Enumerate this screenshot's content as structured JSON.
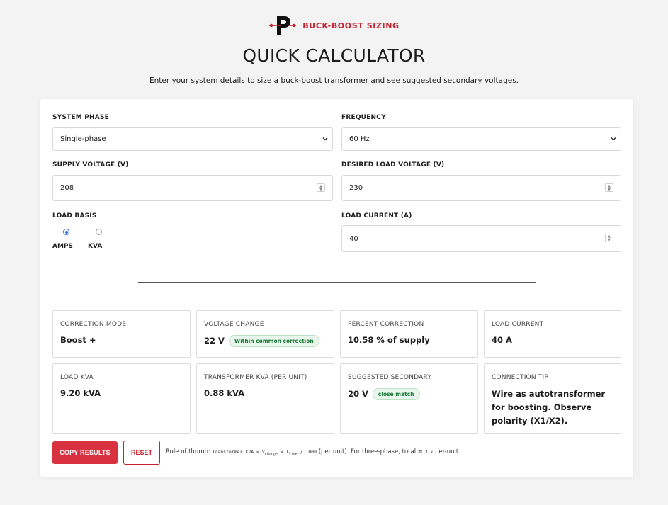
{
  "brand": {
    "name": "BUCK-BOOST SIZING",
    "accent": "#c4232f"
  },
  "header": {
    "title": "QUICK CALCULATOR",
    "subtitle": "Enter your system details to size a buck-boost transformer and see suggested secondary voltages."
  },
  "form": {
    "system_phase": {
      "label": "SYSTEM PHASE",
      "value": "Single-phase"
    },
    "frequency": {
      "label": "FREQUENCY",
      "value": "60 Hz"
    },
    "supply_voltage": {
      "label": "SUPPLY VOLTAGE (V)",
      "value": "208"
    },
    "desired_load_voltage": {
      "label": "DESIRED LOAD VOLTAGE (V)",
      "value": "230"
    },
    "load_basis": {
      "label": "LOAD BASIS",
      "options": [
        "AMPS",
        "KVA"
      ],
      "selected": "AMPS"
    },
    "load_current": {
      "label": "LOAD CURRENT (A)",
      "value": "40"
    }
  },
  "results": [
    {
      "label": "CORRECTION MODE",
      "value": "Boost +"
    },
    {
      "label": "VOLTAGE CHANGE",
      "value": "22 V",
      "badge": "Within common correction"
    },
    {
      "label": "PERCENT CORRECTION",
      "value": "10.58 % of supply"
    },
    {
      "label": "LOAD CURRENT",
      "value": "40 A"
    },
    {
      "label": "LOAD KVA",
      "value": "9.20 kVA"
    },
    {
      "label": "TRANSFORMER KVA (PER UNIT)",
      "value": "0.88 kVA"
    },
    {
      "label": "SUGGESTED SECONDARY",
      "value": "20 V",
      "badge": "close match"
    },
    {
      "label": "CONNECTION TIP",
      "value": "Wire as autotransformer for boosting. Observe polarity (X1/X2)."
    }
  ],
  "actions": {
    "copy_label": "COPY RESULTS",
    "reset_label": "RESET"
  },
  "rule": {
    "prefix": "Rule of thumb:",
    "formula_a": "Transformer kVA = V",
    "sub_change": "change",
    "times": "×",
    "formula_b": "I",
    "sub_line": "line",
    "formula_c": "/ 1000",
    "mid": "(per unit). For three-phase, total ≈",
    "factor": "3 ×",
    "suffix": "per-unit."
  }
}
